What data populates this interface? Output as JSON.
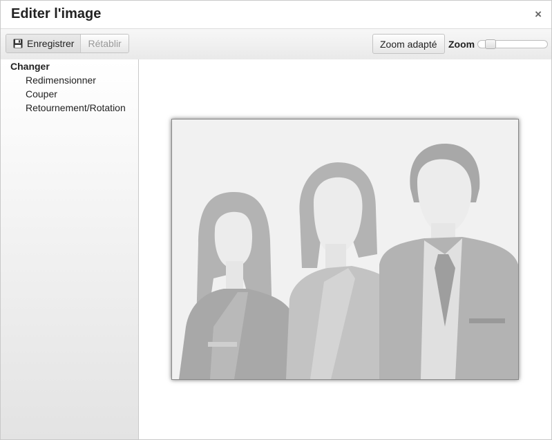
{
  "dialog": {
    "title": "Editer l'image",
    "close_glyph": "×"
  },
  "toolbar": {
    "save_label": "Enregistrer",
    "save_icon": "floppy-disk-icon",
    "undo_label": "Rétablir",
    "zoom_fit_label": "Zoom adapté",
    "zoom_label": "Zoom",
    "zoom_level": 0.12
  },
  "sidebar": {
    "heading": "Changer",
    "items": [
      {
        "label": "Redimensionner"
      },
      {
        "label": "Couper"
      },
      {
        "label": "Retournement/Rotation"
      }
    ]
  },
  "image": {
    "description_icon": "placeholder-people-image"
  },
  "colors": {
    "photo_background": "#f1f1f1",
    "silhouette_dark": "#a8a8a8",
    "silhouette_mid": "#bdbdbd",
    "silhouette_light": "#e6e6e6"
  }
}
